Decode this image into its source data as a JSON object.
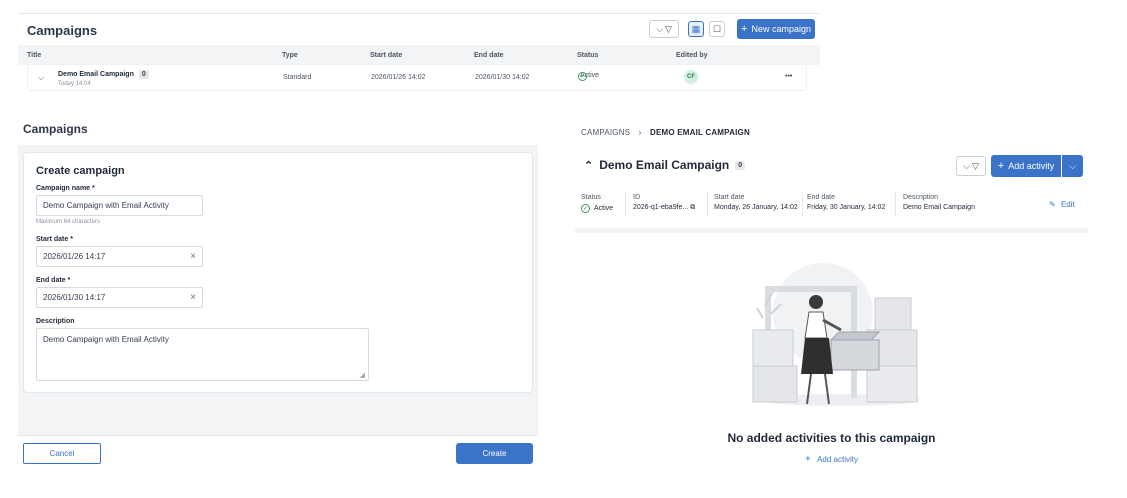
{
  "list": {
    "title": "Campaigns",
    "new_campaign_label": "New campaign",
    "columns": [
      "Title",
      "Type",
      "Start date",
      "End date",
      "Status",
      "Edited by"
    ],
    "row": {
      "title": "Demo Email Campaign",
      "count": "0",
      "subtitle": "Today 14:04",
      "type": "Standard",
      "start": "2026/01/26 14:02",
      "end": "2026/01/30 14:02",
      "status": "Active",
      "edited_by": "CF",
      "more": "•••"
    }
  },
  "create": {
    "page_title": "Campaigns",
    "card_title": "Create campaign",
    "name_label": "Campaign name *",
    "name_value": "Demo Campaign with Email Activity",
    "name_hint": "Maximum 64 characters",
    "start_label": "Start date *",
    "start_value": "2026/01/26 14:17",
    "end_label": "End date *",
    "end_value": "2026/01/30 14:17",
    "desc_label": "Description",
    "desc_value": "Demo Campaign with Email Activity",
    "cancel_label": "Cancel",
    "create_label": "Create"
  },
  "detail": {
    "breadcrumb_root": "CAMPAIGNS",
    "breadcrumb_current": "DEMO EMAIL CAMPAIGN",
    "title": "Demo Email Campaign",
    "count": "0",
    "add_activity_label": "Add activity",
    "status_label": "Status",
    "status_value": "Active",
    "id_label": "ID",
    "id_value": "2026-q1-eba9fe...",
    "start_label": "Start date",
    "start_value": "Monday, 26 January, 14:02",
    "end_label": "End date",
    "end_value": "Friday, 30 January, 14:02",
    "desc_label": "Description",
    "desc_value": "Demo Email Campaign",
    "edit_label": "Edit",
    "empty_title": "No added activities to this campaign",
    "empty_add_label": "Add activity"
  },
  "colors": {
    "accent": "#3b73c9",
    "success": "#3c9a5f"
  }
}
